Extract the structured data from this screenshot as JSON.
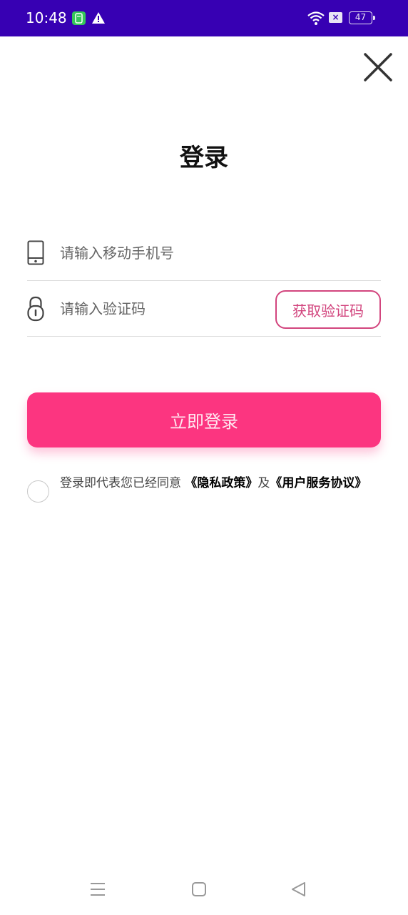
{
  "status_bar": {
    "time": "10:48",
    "battery": "47",
    "color": "#3700b3"
  },
  "page": {
    "title": "登录"
  },
  "form": {
    "phone_placeholder": "请输入移动手机号",
    "code_placeholder": "请输入验证码",
    "get_code_label": "获取验证码",
    "login_label": "立即登录"
  },
  "agreement": {
    "prefix": "登录即代表您已经同意 ",
    "privacy_link": "《隐私政策》",
    "conjunction": "及",
    "service_link": "《用户服务协议》"
  },
  "colors": {
    "accent": "#fc3580",
    "outline_accent": "#d2457e"
  },
  "icons": [
    "signal-app-icon",
    "warning-icon",
    "wifi-icon",
    "no-sim-icon",
    "battery-icon",
    "close-icon",
    "phone-icon",
    "lock-icon",
    "menu-icon",
    "home-icon",
    "back-icon"
  ]
}
